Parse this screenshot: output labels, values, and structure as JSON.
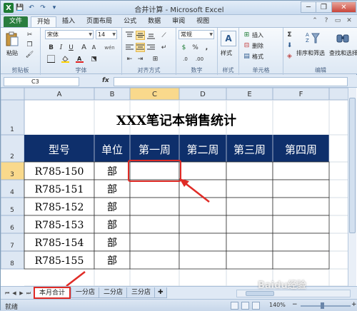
{
  "window": {
    "title": "合并计算 - Microsoft Excel",
    "logo_letter": "X",
    "minimize": "─",
    "restore": "❐",
    "close": "✕"
  },
  "qat": [
    "💾",
    "↶",
    "↷",
    "▾"
  ],
  "ribbon_tabs": [
    "文件",
    "开始",
    "插入",
    "页面布局",
    "公式",
    "数据",
    "审阅",
    "视图"
  ],
  "active_tab": "开始",
  "ribbon": {
    "clipboard": {
      "label": "剪贴板",
      "paste": "粘贴"
    },
    "font": {
      "label": "字体",
      "font_name": "宋体",
      "font_size": "14",
      "bold": "B",
      "italic": "I",
      "underline": "U",
      "grow": "A",
      "shrink": "A",
      "wen": "wén"
    },
    "alignment": {
      "label": "对齐方式"
    },
    "number": {
      "label": "数字",
      "format": "常规",
      "currency": "$",
      "percent": "%",
      "comma": ",",
      "inc_dec": ".0",
      "dec_dec": ".00"
    },
    "styles": {
      "label": "样式",
      "button": "样式"
    },
    "cells": {
      "label": "单元格",
      "insert": "插入",
      "delete": "删除",
      "format": "格式"
    },
    "editing": {
      "label": "编辑",
      "sum": "Σ",
      "sort": "排序和筛选",
      "find": "查找和选择"
    }
  },
  "formula_bar": {
    "name_box": "C3",
    "fx": "fx",
    "content": ""
  },
  "sheet": {
    "columns": [
      "A",
      "B",
      "C",
      "D",
      "E",
      "F"
    ],
    "rows": [
      "1",
      "2",
      "3",
      "4",
      "5",
      "6",
      "7",
      "8"
    ],
    "title": "XXX笔记本销售统计",
    "headers": [
      "型号",
      "单位",
      "第一周",
      "第二周",
      "第三周",
      "第四周"
    ],
    "data": [
      [
        "R785-150",
        "部"
      ],
      [
        "R785-151",
        "部"
      ],
      [
        "R785-152",
        "部"
      ],
      [
        "R785-153",
        "部"
      ],
      [
        "R785-154",
        "部"
      ],
      [
        "R785-155",
        "部"
      ]
    ],
    "header_fill": "#0e2f6b",
    "header_text": "#ffffff",
    "highlight": "#e02b26"
  },
  "sheet_tabs": [
    "本月合计",
    "一分店",
    "二分店",
    "三分店"
  ],
  "active_sheet": "本月合计",
  "status": {
    "text": "就绪",
    "zoom": "140%",
    "zoom_minus": "−",
    "zoom_plus": "+"
  },
  "watermark": "Baidu经验"
}
